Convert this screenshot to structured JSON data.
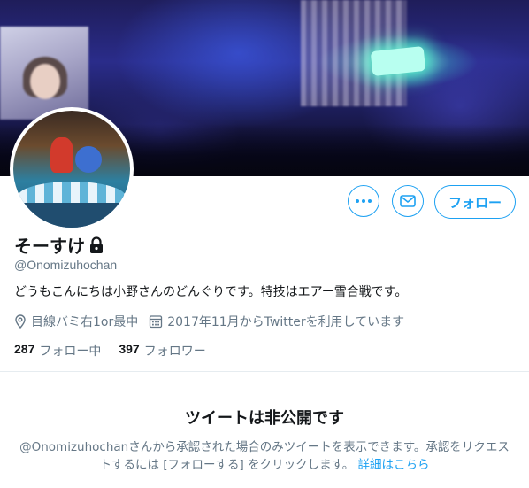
{
  "profile": {
    "display_name": "そーすけ",
    "handle": "@Onomizuhochan",
    "bio": "どうもこんにちは小野さんのどんぐりです。特技はエアー雪合戦です。",
    "location": "目線バミ右1or最中",
    "joined": "2017年11月からTwitterを利用しています",
    "following_count": "287",
    "following_label": "フォロー中",
    "followers_count": "397",
    "followers_label": "フォロワー",
    "protected_icon": "lock-icon"
  },
  "actions": {
    "more_icon": "more-dots-icon",
    "message_icon": "envelope-icon",
    "follow_label": "フォロー"
  },
  "protected_notice": {
    "title": "ツイートは非公開です",
    "text": "@Onomizuhochanさんから承認された場合のみツイートを表示できます。承認をリクエストするには [フォローする] をクリックします。",
    "link_label": "詳細はこちら"
  },
  "colors": {
    "accent": "#1da1f2",
    "secondary_text": "#657786",
    "primary_text": "#14171a",
    "divider": "#e6ecf0"
  }
}
